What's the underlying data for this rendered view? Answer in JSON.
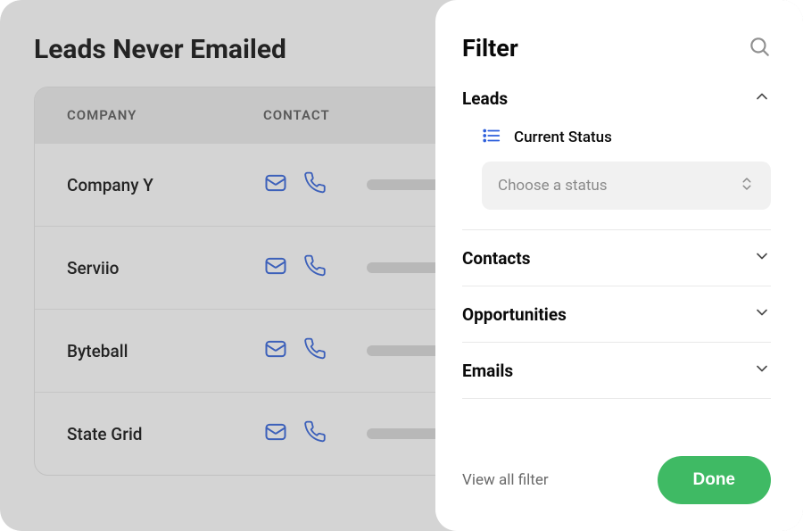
{
  "page": {
    "title": "Leads Never Emailed"
  },
  "table": {
    "headers": {
      "company": "COMPANY",
      "contact": "CONTACT"
    },
    "rows": [
      {
        "company": "Company Y"
      },
      {
        "company": "Serviio"
      },
      {
        "company": "Byteball"
      },
      {
        "company": "State Grid"
      }
    ]
  },
  "filter": {
    "title": "Filter",
    "sections": {
      "leads": {
        "title": "Leads",
        "field_label": "Current Status",
        "select_placeholder": "Choose a status"
      },
      "contacts": {
        "title": "Contacts"
      },
      "opportunities": {
        "title": "Opportunities"
      },
      "emails": {
        "title": "Emails"
      }
    },
    "view_all_label": "View all filter",
    "done_label": "Done"
  },
  "colors": {
    "icon_blue": "#2d5fdb",
    "done_green": "#3fba64"
  }
}
